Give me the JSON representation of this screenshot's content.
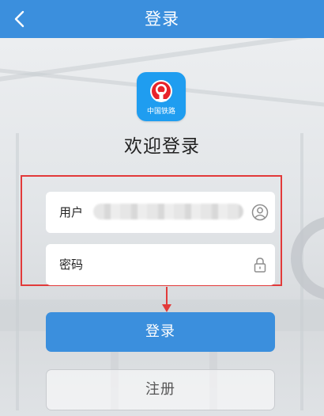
{
  "header": {
    "title": "登录",
    "back_icon": "chevron-left-icon"
  },
  "logo": {
    "text": "中国铁路",
    "icon": "china-railway-logo"
  },
  "welcome": "欢迎登录",
  "form": {
    "username_label": "用户",
    "username_value_masked": true,
    "username_icon": "user-circle-icon",
    "password_label": "密码",
    "password_icon": "lock-icon"
  },
  "buttons": {
    "login": "登录",
    "register": "注册"
  },
  "colors": {
    "primary": "#3b8fdd",
    "highlight": "#e23a3a",
    "logo_bg": "#1f9df0",
    "logo_mark": "#e8232a"
  }
}
